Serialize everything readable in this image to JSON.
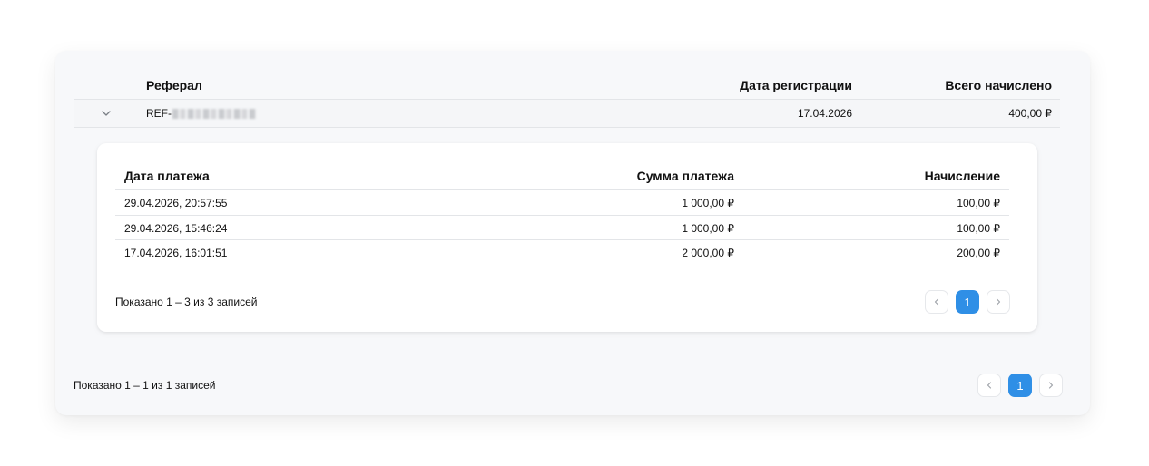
{
  "outer_table": {
    "headers": {
      "referral": "Реферал",
      "registration_date": "Дата регистрации",
      "total_accrued": "Всего начислено"
    },
    "rows": [
      {
        "referral_prefix": "REF-",
        "registration_date": "17.04.2026",
        "total_accrued": "400,00 ₽"
      }
    ],
    "info": "Показано 1 – 1 из 1 записей",
    "pagination": {
      "current": "1"
    }
  },
  "inner_table": {
    "headers": {
      "payment_date": "Дата платежа",
      "payment_amount": "Сумма платежа",
      "accrual": "Начисление"
    },
    "rows": [
      {
        "payment_date": "29.04.2026, 20:57:55",
        "payment_amount": "1 000,00 ₽",
        "accrual": "100,00 ₽"
      },
      {
        "payment_date": "29.04.2026, 15:46:24",
        "payment_amount": "1 000,00 ₽",
        "accrual": "100,00 ₽"
      },
      {
        "payment_date": "17.04.2026, 16:01:51",
        "payment_amount": "2 000,00 ₽",
        "accrual": "200,00 ₽"
      }
    ],
    "info": "Показано 1 – 3 из 3 записей",
    "pagination": {
      "current": "1"
    }
  },
  "colors": {
    "accent": "#2f8fe6",
    "card_background": "#f7f8fa",
    "border": "#e3e5e8"
  },
  "icons": {
    "expand": "chevron-down-icon",
    "prev": "chevron-left-icon",
    "next": "chevron-right-icon"
  }
}
